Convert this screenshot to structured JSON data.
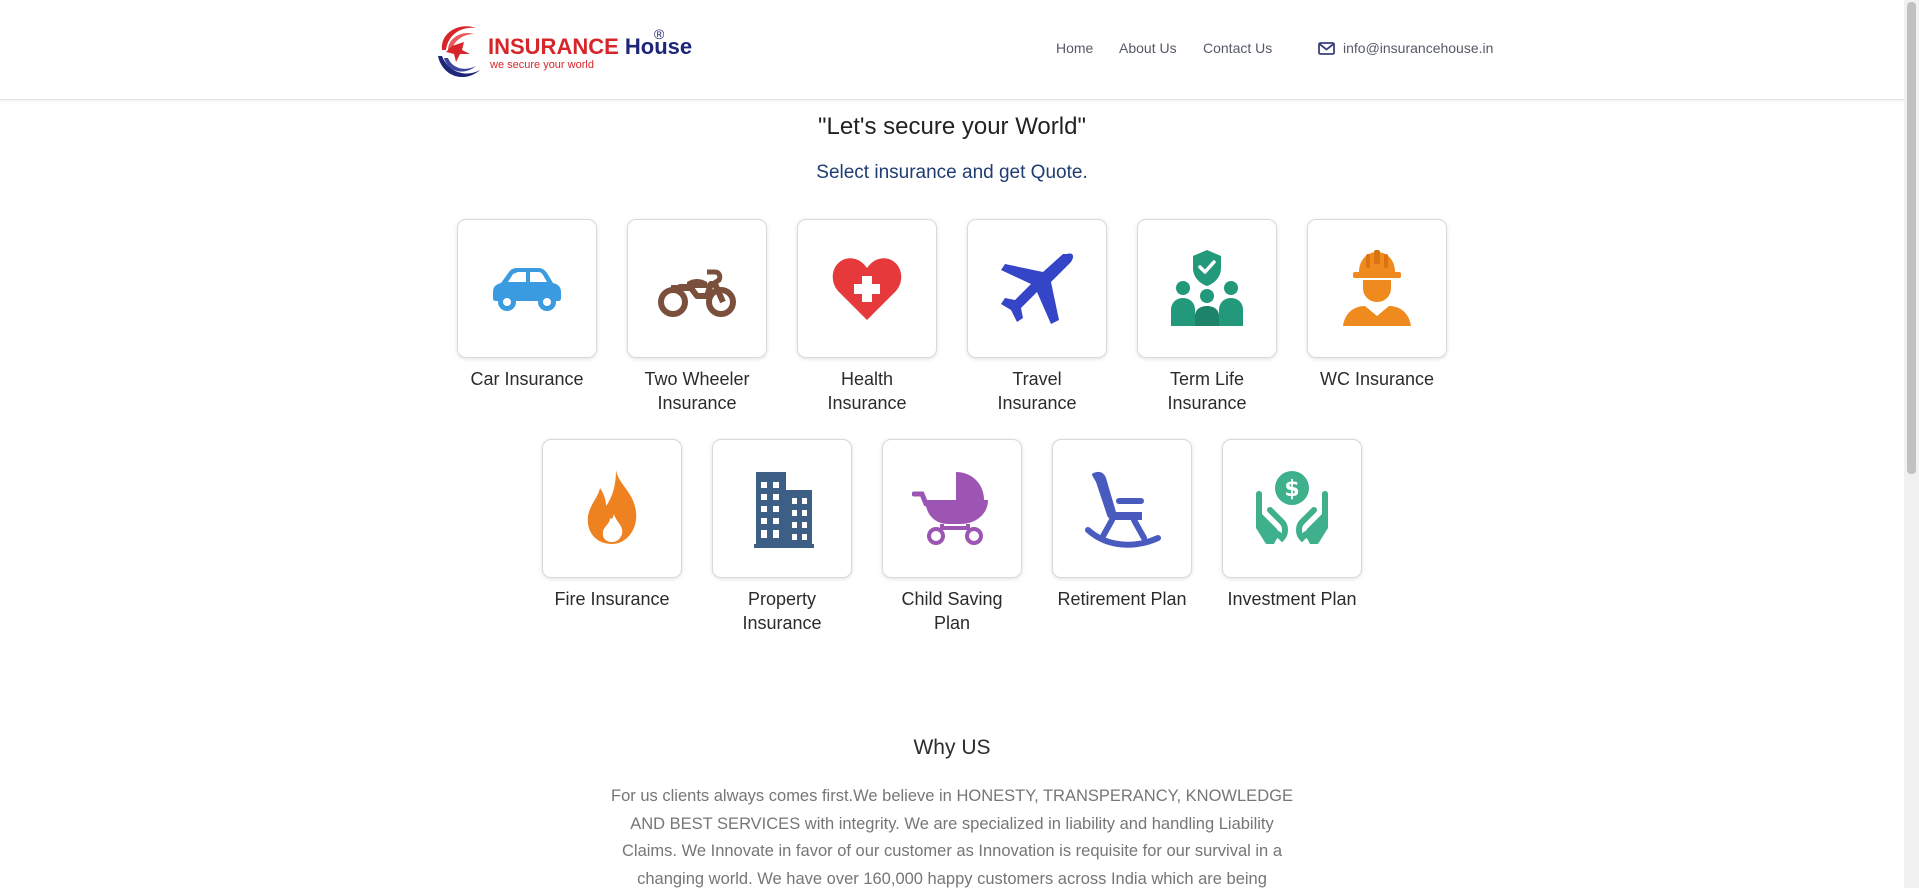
{
  "header": {
    "logo": {
      "name_part1": "INSURANCE",
      "name_part2": "House",
      "registered": "®",
      "tagline": "we secure your world"
    },
    "nav": {
      "home": "Home",
      "about": "About Us",
      "contact": "Contact Us"
    },
    "email": "info@insurancehouse.in",
    "email_icon": "envelope-icon"
  },
  "hero": {
    "title": "\"Let's secure your World\"",
    "subtitle": "Select insurance and get Quote."
  },
  "products": [
    {
      "label": "Car Insurance",
      "icon": "car-icon",
      "color": "#3a9be0"
    },
    {
      "label": "Two Wheeler Insurance",
      "icon": "motorcycle-icon",
      "color": "#7a4f3c"
    },
    {
      "label": "Health Insurance",
      "icon": "heart-plus-icon",
      "color": "#e5393b"
    },
    {
      "label": "Travel Insurance",
      "icon": "airplane-icon",
      "color": "#3545c8"
    },
    {
      "label": "Term Life Insurance",
      "icon": "family-shield-icon",
      "color": "#22997a"
    },
    {
      "label": "WC Insurance",
      "icon": "worker-helmet-icon",
      "color": "#ef8a1e"
    },
    {
      "label": "Fire Insurance",
      "icon": "fire-icon",
      "color": "#ef8220"
    },
    {
      "label": "Property Insurance",
      "icon": "building-icon",
      "color": "#3d5f86"
    },
    {
      "label": "Child Saving Plan",
      "icon": "baby-stroller-icon",
      "color": "#9c55b3"
    },
    {
      "label": "Retirement Plan",
      "icon": "rocking-chair-icon",
      "color": "#4a5bc0"
    },
    {
      "label": "Investment Plan",
      "icon": "hand-holding-dollar-icon",
      "color": "#3fb08c"
    }
  ],
  "why_us": {
    "title": "Why US",
    "text": "For us clients always comes first.We believe in HONESTY, TRANSPERANCY, KNOWLEDGE AND BEST SERVICES with integrity. We are specialized in liability and handling Liability Claims. We Innovate in favor of our customer as Innovation is requisite for our survival in a changing world. We have over 160,000 happy customers across India which are being supported by energetic"
  },
  "colors": {
    "brand_red": "#d7262b",
    "brand_navy": "#1d2677",
    "subtitle_blue": "#1f3d73"
  }
}
